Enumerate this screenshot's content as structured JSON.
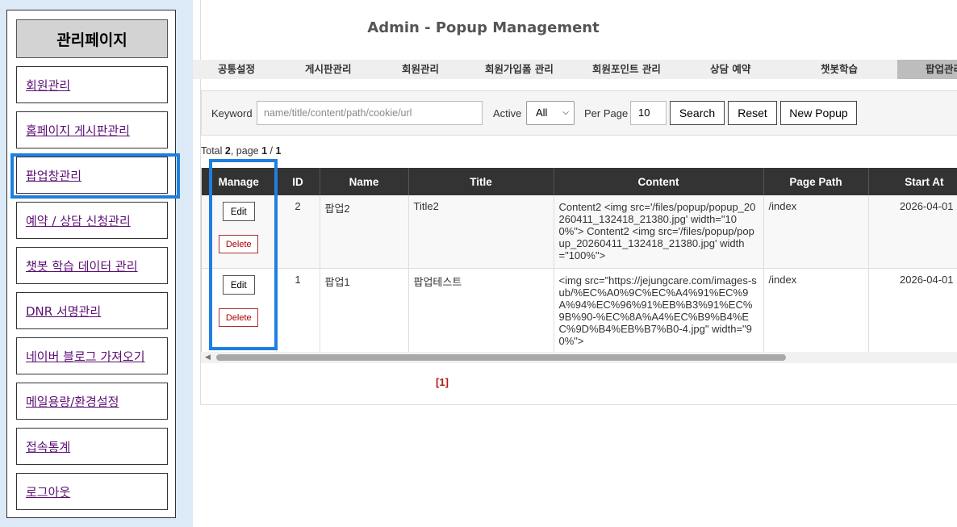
{
  "sidebar": {
    "title": "관리페이지",
    "items": [
      {
        "label": "회원관리"
      },
      {
        "label": "홈페이지 게시판관리"
      },
      {
        "label": "팝업창관리"
      },
      {
        "label": "예약 / 상담 신청관리"
      },
      {
        "label": "챗봇 학습 데이터 관리"
      },
      {
        "label": "DNR 서명관리"
      },
      {
        "label": "네이버 블로그 가져오기"
      },
      {
        "label": "메일용량/환경설정"
      },
      {
        "label": "접속통계"
      },
      {
        "label": "로그아웃"
      }
    ]
  },
  "header": {
    "title": "Admin - Popup Management"
  },
  "topnav": {
    "tabs": [
      {
        "label": "공통설정"
      },
      {
        "label": "게시판관리"
      },
      {
        "label": "회원관리"
      },
      {
        "label": "회원가입폼 관리"
      },
      {
        "label": "회원포인트 관리"
      },
      {
        "label": "상담 예약"
      },
      {
        "label": "챗봇학습"
      },
      {
        "label": "팝업관리"
      }
    ]
  },
  "search": {
    "keyword_label": "Keyword",
    "keyword_placeholder": "name/title/content/path/cookie/url",
    "active_label": "Active",
    "active_value": "All",
    "per_page_label": "Per Page",
    "per_page_value": "10",
    "search_button": "Search",
    "reset_button": "Reset",
    "new_button": "New Popup"
  },
  "summary": {
    "prefix": "Total ",
    "total": "2",
    "mid": ", page ",
    "page": "1",
    "sep": " / ",
    "pages": "1"
  },
  "table": {
    "headers": [
      "Manage",
      "ID",
      "Name",
      "Title",
      "Content",
      "Page Path",
      "Start At"
    ],
    "edit_label": "Edit",
    "delete_label": "Delete",
    "rows": [
      {
        "id": "2",
        "name": "팝업2",
        "title": "Title2",
        "content": "Content2 <img src='/files/popup/popup_20260411_132418_21380.jpg' width=\"100%\"> Content2 <img src='/files/popup/popup_20260411_132418_21380.jpg' width=\"100%\">",
        "path": "/index",
        "start": "2026-04-01"
      },
      {
        "id": "1",
        "name": "팝업1",
        "title": "팝업테스트",
        "content": "<img src=\"https://jejungcare.com/images-sub/%EC%A0%9C%EC%A4%91%EC%9A%94%EC%96%91%EB%B3%91%EC%9B%90-%EC%8A%A4%EC%B9%B4%EC%9D%B4%EB%B7%B0-4.jpg\" width=\"90%\">",
        "path": "/index",
        "start": "2026-04-01"
      }
    ]
  },
  "pager": {
    "current": "[1]"
  },
  "colors": {
    "highlight": "#1e7fe0",
    "header_bg": "#333333",
    "link": "#5c0f73",
    "pager": "#b21818"
  }
}
